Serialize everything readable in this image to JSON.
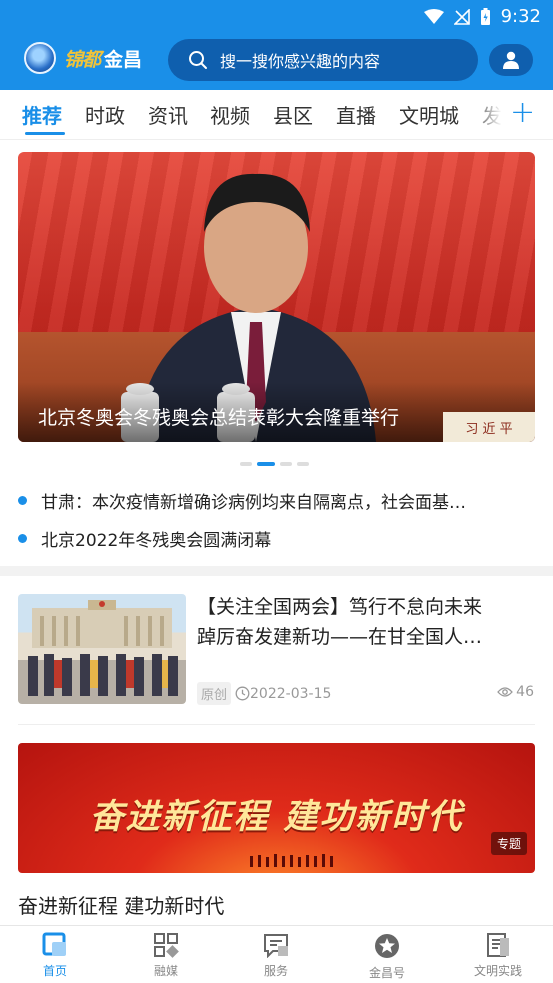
{
  "status_bar": {
    "time": "9:32"
  },
  "header": {
    "logo_mark_text": "锦都",
    "logo_name": "金昌",
    "search_placeholder": "搜一搜你感兴趣的内容"
  },
  "tabs": [
    {
      "label": "推荐",
      "active": true
    },
    {
      "label": "时政"
    },
    {
      "label": "资讯"
    },
    {
      "label": "视频"
    },
    {
      "label": "县区"
    },
    {
      "label": "直播"
    },
    {
      "label": "文明城"
    },
    {
      "label": "发"
    }
  ],
  "hero": {
    "title": "北京冬奥会冬残奥会总结表彰大会隆重举行",
    "nameplate": "习 近 平",
    "slides": 4,
    "active_slide": 2
  },
  "headlines": [
    "甘肃：本次疫情新增确诊病例均来自隔离点，社会面基…",
    "北京2022年冬残奥会圆满闭幕"
  ],
  "article": {
    "title_line1": "【关注全国两会】笃行不怠向未来",
    "title_line2": "踔厉奋发建新功——在甘全国人…",
    "tag": "原创",
    "date": "2022-03-15",
    "views": "46"
  },
  "banner": {
    "slogan": "奋进新征程  建功新时代",
    "badge": "专题",
    "caption": "奋进新征程  建功新时代"
  },
  "bottom_nav": [
    {
      "label": "首页",
      "icon": "home-icon",
      "active": true
    },
    {
      "label": "融媒",
      "icon": "grid-icon"
    },
    {
      "label": "服务",
      "icon": "service-chat-icon"
    },
    {
      "label": "金昌号",
      "icon": "star-badge-icon"
    },
    {
      "label": "文明实践",
      "icon": "document-icon"
    }
  ],
  "colors": {
    "primary": "#1a8fe8",
    "header_dark": "#0f5fae"
  }
}
